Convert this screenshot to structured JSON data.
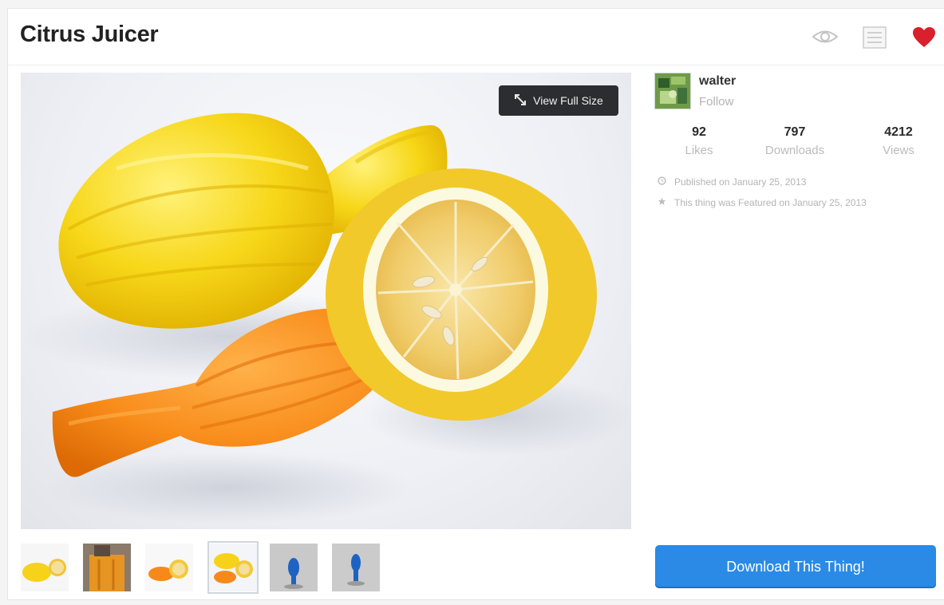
{
  "header": {
    "title": "Citrus Juicer",
    "icons": [
      "eye-icon",
      "list-icon",
      "heart-icon"
    ],
    "heart_color": "#d9202c"
  },
  "hero": {
    "view_full_size_label": "View Full Size",
    "view_full_size_icon": "diagonal-arrows-icon"
  },
  "thumbnails": {
    "count": 6,
    "active_index": 3
  },
  "author": {
    "username": "walter",
    "follow_label": "Follow"
  },
  "stats": [
    {
      "value": "92",
      "label": "Likes"
    },
    {
      "value": "797",
      "label": "Downloads"
    },
    {
      "value": "4212",
      "label": "Views"
    }
  ],
  "meta": [
    {
      "icon": "clock-icon",
      "text": "Published on January 25, 2013"
    },
    {
      "icon": "star-icon",
      "text": "This thing was Featured on January 25, 2013"
    }
  ],
  "download": {
    "label": "Download This Thing!",
    "color": "#2a8ae6"
  }
}
